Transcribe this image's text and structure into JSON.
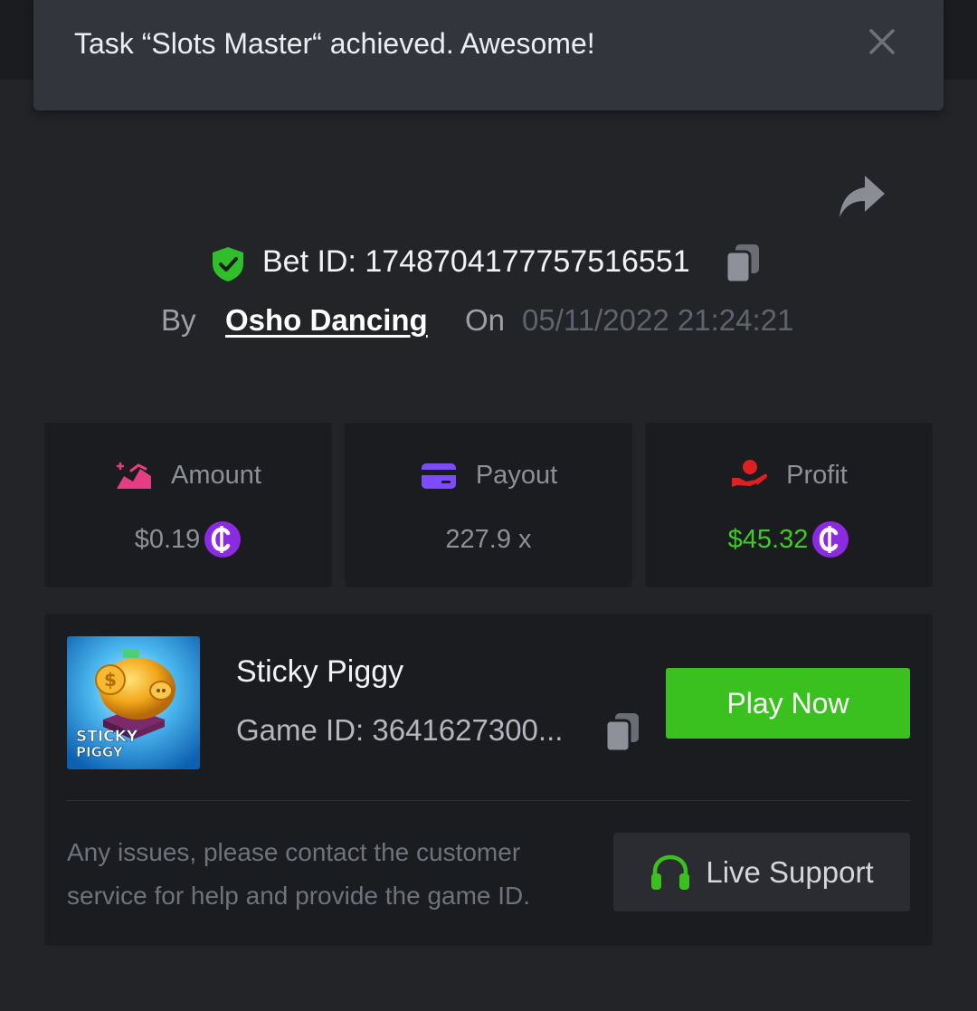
{
  "toast": {
    "message": "Task “Slots Master“ achieved. Awesome!",
    "close_icon": "close-icon"
  },
  "bet": {
    "id_text": "Bet ID: 1748704177757516551",
    "by_label": "By",
    "user": "Osho Dancing",
    "on_label": "On",
    "datetime": "05/11/2022 21:24:21"
  },
  "stats": {
    "amount": {
      "label": "Amount",
      "value": "$0.19",
      "icon": "amount-icon"
    },
    "payout": {
      "label": "Payout",
      "value": "227.9 x",
      "icon": "card-icon"
    },
    "profit": {
      "label": "Profit",
      "value": "$45.32",
      "icon": "hand-coin-icon"
    }
  },
  "game": {
    "name": "Sticky Piggy",
    "id_text": "Game ID: 3641627300...",
    "thumb_title_line1": "STICKY",
    "thumb_title_line2": "PIGGY",
    "play_label": "Play Now"
  },
  "support": {
    "help_text": "Any issues, please contact the customer service for help and provide the game ID.",
    "button_label": "Live Support"
  },
  "colors": {
    "background": "#232428",
    "card": "#1b1c20",
    "accent_green": "#3bc11f",
    "profit_green": "#3ecb23",
    "coin_purple": "#8a2be2",
    "amount_pink": "#e43d84",
    "payout_purple": "#7c4dff",
    "profit_red": "#e02020"
  }
}
